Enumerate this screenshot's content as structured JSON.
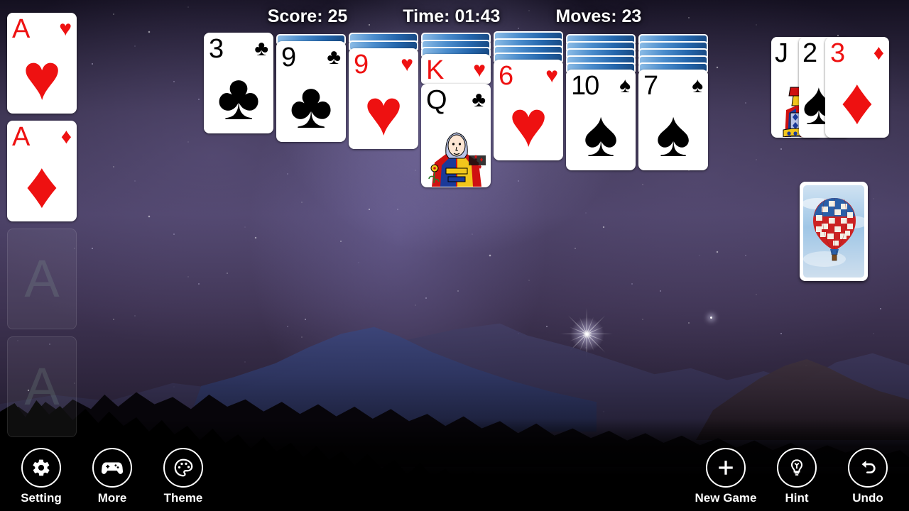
{
  "hud": {
    "score": "Score: 25",
    "time": "Time: 01:43",
    "moves": "Moves: 23"
  },
  "theme": {
    "background": "starry-night-mountain",
    "card_back": "hot-air-balloon",
    "red_suit_color": "#ee1111",
    "black_suit_color": "#000000",
    "card_back_color": "#2466ac"
  },
  "foundations": [
    {
      "name": "foundation-hearts",
      "rank": "A",
      "suit": "♥",
      "color": "red",
      "empty": false
    },
    {
      "name": "foundation-diamonds",
      "rank": "A",
      "suit": "♦",
      "color": "red",
      "empty": false
    },
    {
      "name": "foundation-clubs",
      "placeholder": "A",
      "empty": true
    },
    {
      "name": "foundation-spades",
      "placeholder": "A",
      "empty": true
    }
  ],
  "tableau": [
    {
      "column": 1,
      "facedown": 0,
      "faceup": [
        {
          "rank": "3",
          "suit": "♣",
          "color": "black"
        }
      ]
    },
    {
      "column": 2,
      "facedown": 1,
      "faceup": [
        {
          "rank": "9",
          "suit": "♣",
          "color": "black"
        }
      ]
    },
    {
      "column": 3,
      "facedown": 2,
      "faceup": [
        {
          "rank": "9",
          "suit": "♥",
          "color": "red"
        }
      ]
    },
    {
      "column": 4,
      "facedown": 3,
      "faceup": [
        {
          "rank": "K",
          "suit": "♥",
          "color": "red"
        },
        {
          "rank": "Q",
          "suit": "♣",
          "color": "black"
        }
      ]
    },
    {
      "column": 5,
      "facedown": 4,
      "faceup": [
        {
          "rank": "6",
          "suit": "♥",
          "color": "red"
        }
      ]
    },
    {
      "column": 6,
      "facedown": 5,
      "faceup": [
        {
          "rank": "10",
          "suit": "♠",
          "color": "black"
        }
      ]
    },
    {
      "column": 7,
      "facedown": 5,
      "faceup": [
        {
          "rank": "7",
          "suit": "♠",
          "color": "black"
        }
      ]
    }
  ],
  "waste": [
    {
      "rank": "J",
      "suit": "♠",
      "color": "black"
    },
    {
      "rank": "2",
      "suit": "♠",
      "color": "black"
    },
    {
      "rank": "3",
      "suit": "♦",
      "color": "red"
    }
  ],
  "stock": {
    "label": "stock-pile",
    "face_down": true
  },
  "toolbar_left": [
    {
      "label": "Setting",
      "icon": "gear-icon"
    },
    {
      "label": "More",
      "icon": "gamepad-icon"
    },
    {
      "label": "Theme",
      "icon": "palette-icon"
    }
  ],
  "toolbar_right": [
    {
      "label": "New Game",
      "icon": "plus-icon"
    },
    {
      "label": "Hint",
      "icon": "lightbulb-icon"
    },
    {
      "label": "Undo",
      "icon": "undo-arrow-icon"
    }
  ]
}
